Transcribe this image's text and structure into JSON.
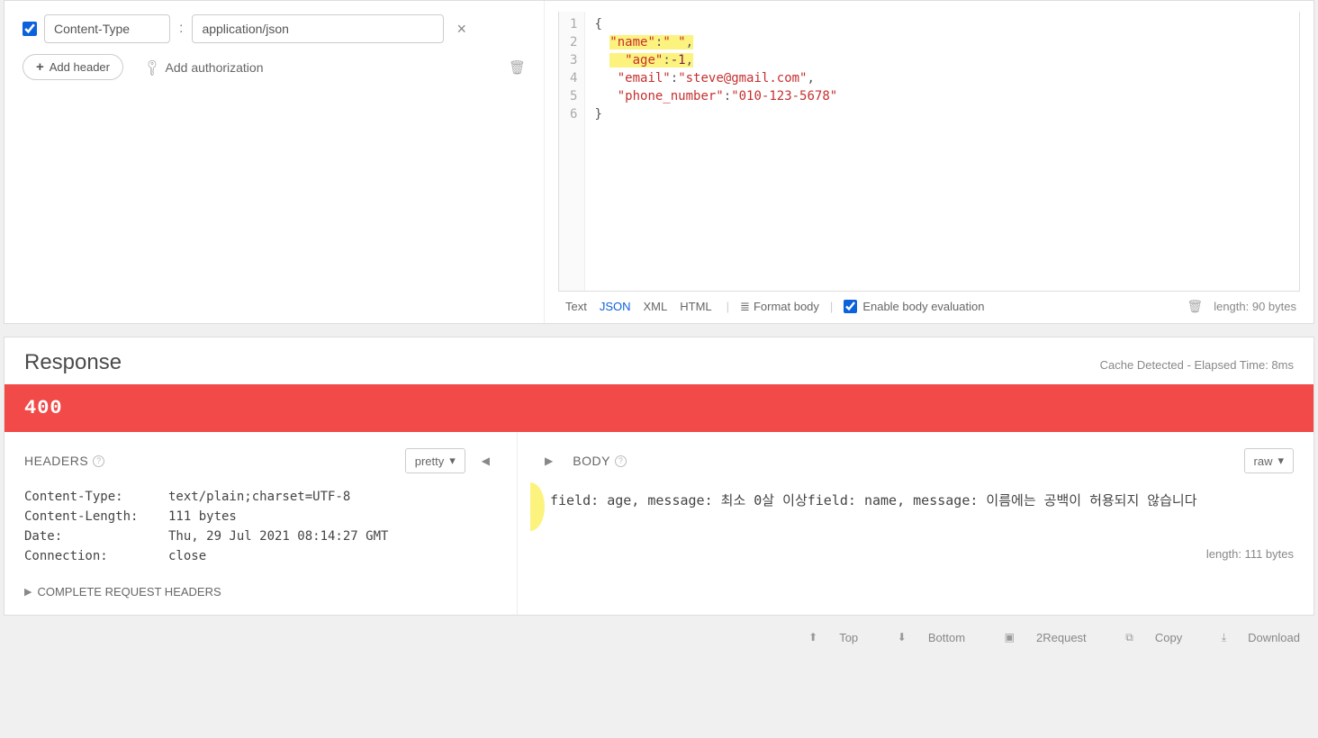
{
  "request": {
    "header": {
      "enabled": true,
      "key": "Content-Type",
      "value": "application/json"
    },
    "add_header_label": "Add header",
    "add_auth_label": "Add authorization"
  },
  "editor": {
    "lines": [
      "1",
      "2",
      "3",
      "4",
      "5",
      "6"
    ],
    "l1_open": "{",
    "l2_k": "\"name\"",
    "l2_c": ":",
    "l2_v": "\" \"",
    "l2_t": ",",
    "l3_k": "\"age\"",
    "l3_c": ":",
    "l3_v": "-1",
    "l3_t": ",",
    "l4_k": "\"email\"",
    "l4_c": ":",
    "l4_v": "\"steve@gmail.com\"",
    "l4_t": ",",
    "l5_k": "\"phone_number\"",
    "l5_c": ":",
    "l5_v": "\"010-123-5678\"",
    "l6_close": "}",
    "tabs": {
      "text": "Text",
      "json": "JSON",
      "xml": "XML",
      "html": "HTML"
    },
    "format": "Format body",
    "enable_eval": "Enable body evaluation",
    "length": "length: 90 bytes"
  },
  "response": {
    "title": "Response",
    "meta": "Cache Detected - Elapsed Time: 8ms",
    "status": "400",
    "headers_title": "HEADERS",
    "pretty": "pretty",
    "headers": [
      {
        "k": "Content-Type:",
        "v": "text/plain;charset=UTF-8"
      },
      {
        "k": "Content-Length:",
        "v": "111 bytes"
      },
      {
        "k": "Date:",
        "v": "Thu, 29 Jul 2021 08:14:27 GMT"
      },
      {
        "k": "Connection:",
        "v": "close"
      }
    ],
    "complete_hdrs": "COMPLETE REQUEST HEADERS",
    "body_title": "BODY",
    "raw": "raw",
    "body_text": "field: age,      message: 최소 0살 이상field: name,      message: 이름에는 공백이 허용되지 않습니다",
    "length": "length: 111 bytes"
  },
  "footer": {
    "top": "Top",
    "bottom": "Bottom",
    "request": "2Request",
    "copy": "Copy",
    "download": "Download"
  }
}
